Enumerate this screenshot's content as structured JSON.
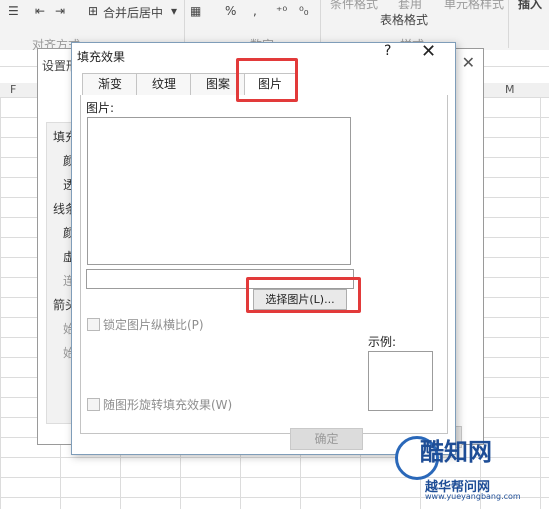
{
  "ribbon": {
    "merge_center": "合并后居中",
    "percent": "%",
    "comma": ",",
    "cond_format": "条件格式",
    "table": "套用",
    "table2": "表格格式",
    "cell_style": "单元格样式",
    "insert": "插入",
    "align_group": "对齐方式",
    "number_group": "数字",
    "style_group": "样式"
  },
  "columns": [
    "F",
    "M"
  ],
  "bg_dialog": {
    "title": "设置形状格式",
    "close": "✕",
    "left_items": [
      "填充",
      "颜",
      "透",
      "线条",
      "颜",
      "虚",
      "连",
      "箭头",
      "始",
      "始"
    ]
  },
  "dialog": {
    "title": "填充效果",
    "help": "?",
    "close": "✕",
    "tabs": [
      "渐变",
      "纹理",
      "图案",
      "图片"
    ],
    "active_tab": "图片",
    "picture_label": "图片:",
    "select_button": "选择图片(L)...",
    "lock_ratio": "锁定图片纵横比(P)",
    "sample_label": "示例:",
    "rotate_with_shape": "随图形旋转填充效果(W)",
    "ok": "确定"
  },
  "watermark": {
    "brand": "酷知网",
    "sub": "越华帮问网",
    "url": "www.yueyangbang.com"
  },
  "colors": {
    "highlight": "#e23a3a",
    "dialog_border": "#7f9db9",
    "watermark": "#1e4d96"
  }
}
